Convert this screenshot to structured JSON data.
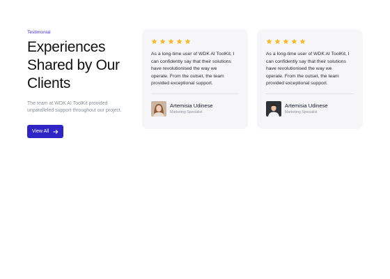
{
  "hero": {
    "eyebrow": "Testimonial",
    "headline_lines": [
      "Experiences",
      "Shared by Our",
      "Clients"
    ],
    "description_lines": [
      "The team at WDK AI ToolKit provided",
      "unparalleled support throughout our project."
    ],
    "button_label": "View All"
  },
  "colors": {
    "accent": "#2f25c6",
    "star": "#f6b92b",
    "card_bg": "#f6f6f8"
  },
  "testimonials": [
    {
      "rating": 5,
      "quote_lines": [
        "As a long-time user of WDK AI ToolKit, I",
        "can confidently say that their solutions",
        "have revolutionised the way we",
        "operate. From the outset, the team",
        "provided exceptional support."
      ],
      "author_name": "Artemisia Udinese",
      "author_role": "Marketing Specialist"
    },
    {
      "rating": 5,
      "quote_lines": [
        "As a long-time user of WDK AI ToolKit, I",
        "can confidently say that their solutions",
        "have revolutionised the way we",
        "operate. From the outset, the team",
        "provided exceptional support."
      ],
      "author_name": "Artemisia Udinese",
      "author_role": "Marketing Specialist"
    }
  ]
}
